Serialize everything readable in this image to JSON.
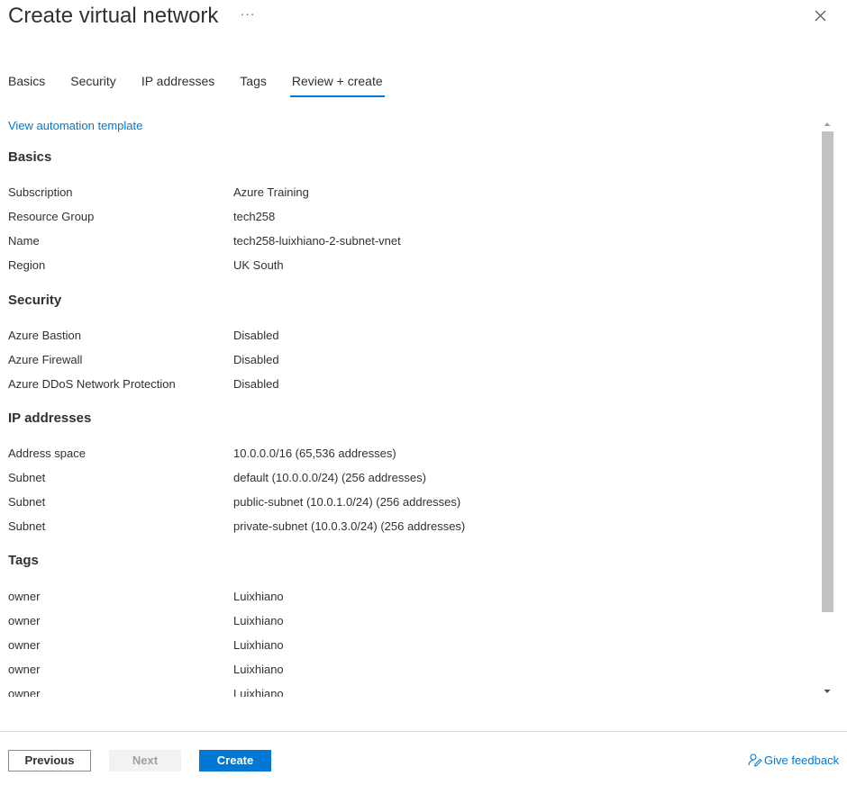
{
  "header": {
    "title": "Create virtual network",
    "more_label": "···"
  },
  "tabs": [
    {
      "label": "Basics"
    },
    {
      "label": "Security"
    },
    {
      "label": "IP addresses"
    },
    {
      "label": "Tags"
    },
    {
      "label": "Review + create",
      "active": true
    }
  ],
  "review": {
    "automation_link": "View automation template",
    "basics": {
      "heading": "Basics",
      "rows": [
        {
          "label": "Subscription",
          "value": "Azure Training"
        },
        {
          "label": "Resource Group",
          "value": "tech258"
        },
        {
          "label": "Name",
          "value": "tech258-luixhiano-2-subnet-vnet"
        },
        {
          "label": "Region",
          "value": "UK South"
        }
      ]
    },
    "security": {
      "heading": "Security",
      "rows": [
        {
          "label": "Azure Bastion",
          "value": "Disabled"
        },
        {
          "label": "Azure Firewall",
          "value": "Disabled"
        },
        {
          "label": "Azure DDoS Network Protection",
          "value": "Disabled"
        }
      ]
    },
    "ip_addresses": {
      "heading": "IP addresses",
      "rows": [
        {
          "label": "Address space",
          "value": "10.0.0.0/16 (65,536 addresses)"
        },
        {
          "label": "Subnet",
          "value": "default (10.0.0.0/24) (256 addresses)"
        },
        {
          "label": "Subnet",
          "value": "public-subnet (10.0.1.0/24) (256 addresses)"
        },
        {
          "label": "Subnet",
          "value": "private-subnet (10.0.3.0/24) (256 addresses)"
        }
      ]
    },
    "tags": {
      "heading": "Tags",
      "rows": [
        {
          "label": "owner",
          "value": "Luixhiano"
        },
        {
          "label": "owner",
          "value": "Luixhiano"
        },
        {
          "label": "owner",
          "value": "Luixhiano"
        },
        {
          "label": "owner",
          "value": "Luixhiano"
        },
        {
          "label": "owner",
          "value": "Luixhiano"
        }
      ]
    }
  },
  "footer": {
    "previous_label": "Previous",
    "next_label": "Next",
    "create_label": "Create",
    "feedback_label": "Give feedback"
  },
  "colors": {
    "accent": "#0078d4",
    "text": "#323130",
    "disabled_bg": "#f3f2f1",
    "disabled_text": "#a19f9d"
  },
  "icons": {
    "close": "close-icon",
    "feedback": "feedback-person-icon",
    "scroll_up": "chevron-up-icon",
    "scroll_down": "chevron-down-icon"
  }
}
